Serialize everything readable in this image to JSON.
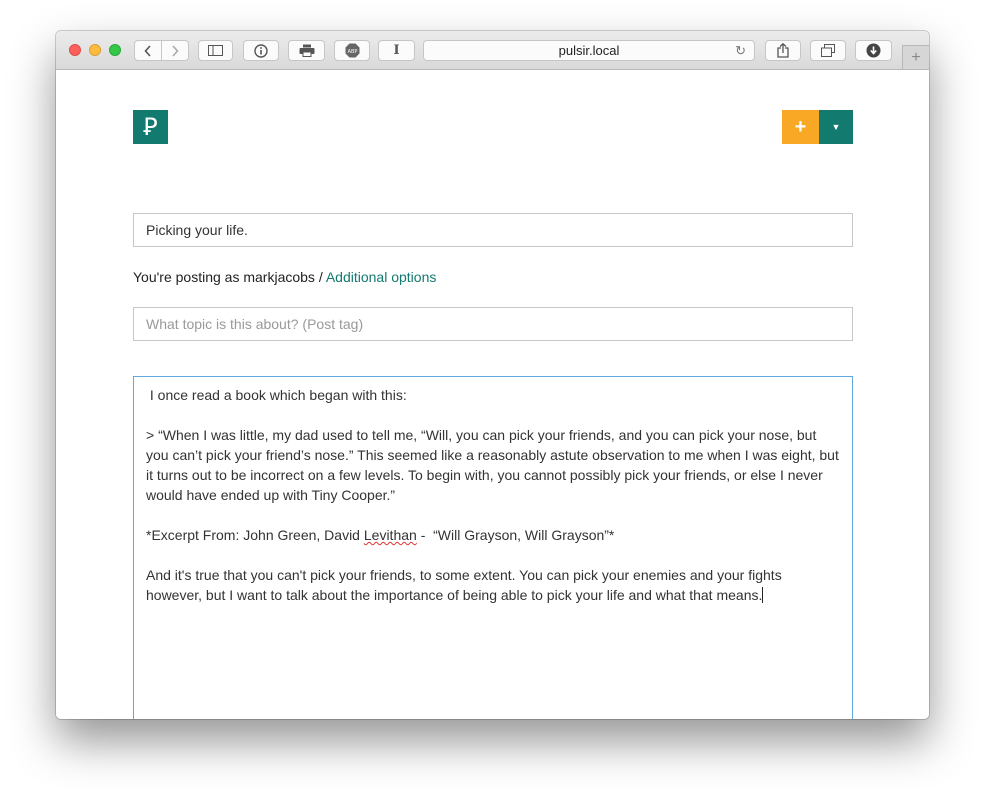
{
  "browser": {
    "url": "pulsir.local",
    "newtab_label": "+"
  },
  "site": {
    "logo_text": "Ꝑ",
    "add_label": "+",
    "dropdown_label": "▼"
  },
  "form": {
    "title_value": "Picking your life.",
    "posting_as_prefix": "You're posting as markjacobs / ",
    "additional_options_link": "Additional options",
    "tag_placeholder": "What topic is this about? (Post tag)",
    "body": {
      "line1": " I once read a book which began with this:",
      "quote": "> “When I was little, my dad used to tell me, “Will, you can pick your friends, and you can pick your nose, but you can’t pick your friend’s nose.” This seemed like a reasonably astute observation to me when I was eight, but it turns out to be incorrect on a few levels. To begin with, you cannot possibly pick your friends, or else I never would have ended up with Tiny Cooper.”",
      "excerpt_prefix": "*Excerpt From: John Green, David ",
      "excerpt_name": "Levithan",
      "excerpt_suffix": " -  “Will Grayson, Will Grayson”*",
      "closing": "And it's true that you can't pick your friends, to some extent. You can pick your enemies and your fights however, but I want to talk about the importance of being able to pick your life and what that means."
    }
  },
  "colors": {
    "brand_teal": "#127a6f",
    "accent_orange": "#f9a825",
    "focus_blue": "#5fa9e0"
  }
}
